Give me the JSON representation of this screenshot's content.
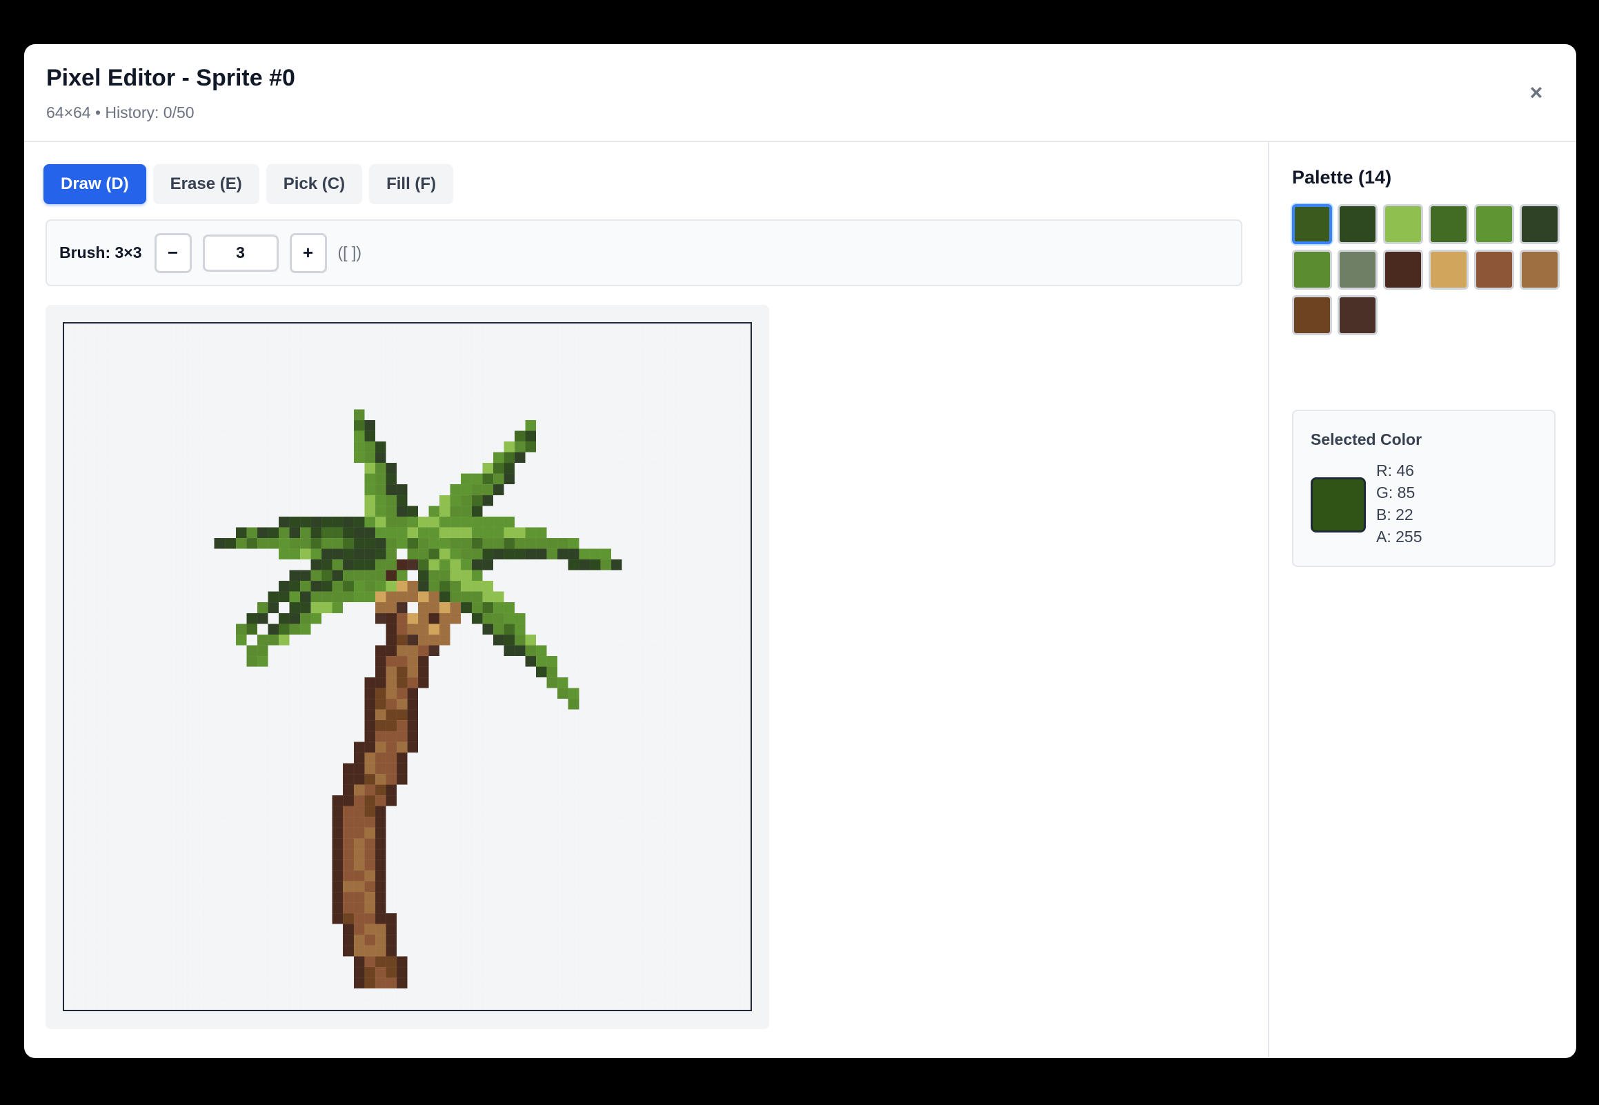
{
  "header": {
    "title": "Pixel Editor - Sprite #0",
    "subtitle": "64×64 • History: 0/50",
    "close_label": "×"
  },
  "tools": [
    {
      "label": "Draw (D)",
      "active": true
    },
    {
      "label": "Erase (E)",
      "active": false
    },
    {
      "label": "Pick (C)",
      "active": false
    },
    {
      "label": "Fill (F)",
      "active": false
    }
  ],
  "brush": {
    "label": "Brush: 3×3",
    "decrement_label": "−",
    "increment_label": "+",
    "value": "3",
    "shortcut": "([ ])"
  },
  "canvas": {
    "grid_size": 64,
    "sprite": "palm tree"
  },
  "palette": {
    "title": "Palette (14)",
    "selected_index": 0,
    "colors": [
      "#3a5a1e",
      "#2e4820",
      "#8fbf4f",
      "#426b24",
      "#5f9631",
      "#2f4226",
      "#5c8c30",
      "#6f7f66",
      "#4a2a1e",
      "#d1a55c",
      "#8c5637",
      "#9e6f3f",
      "#6e4322",
      "#4a3027"
    ]
  },
  "selected_color": {
    "title": "Selected Color",
    "hex": "#2e5516",
    "r": "R: 46",
    "g": "G: 85",
    "b": "B: 22",
    "a": "A: 255"
  }
}
